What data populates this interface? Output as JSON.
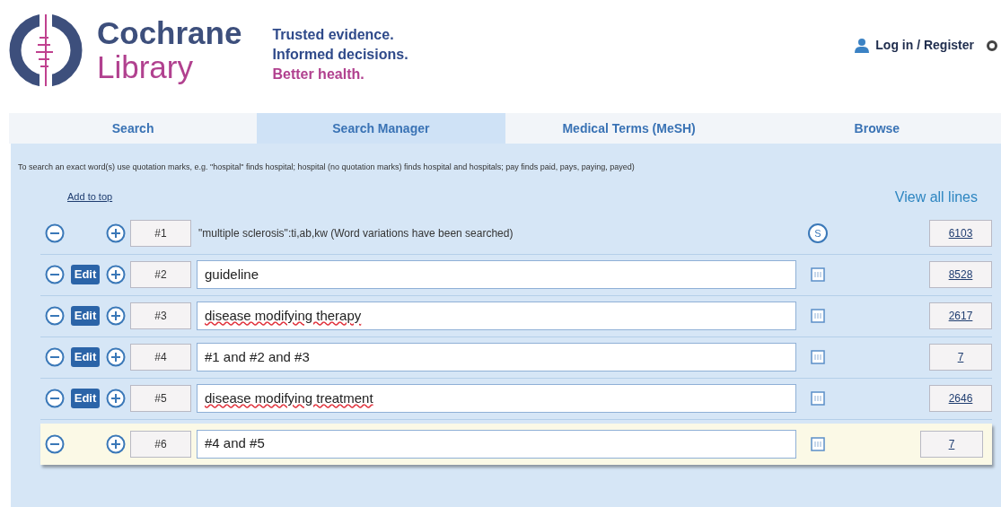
{
  "header": {
    "logo": {
      "line_1": "Cochrane",
      "line_2": "Library"
    },
    "tagline": [
      "Trusted evidence.",
      "Informed decisions.",
      "Better health."
    ],
    "login": "Log in / Register"
  },
  "tabs": [
    {
      "label": "Search",
      "selected": false
    },
    {
      "label": "Search Manager",
      "selected": true
    },
    {
      "label": "Medical Terms (MeSH)",
      "selected": false
    },
    {
      "label": "Browse",
      "selected": false
    }
  ],
  "hint": "To search an exact word(s) use quotation marks, e.g. \"hospital\" finds hospital; hospital (no quotation marks) finds hospital and hospitals; pay finds paid, pays, paying, payed)",
  "add_to_top": "Add to top",
  "view_all_lines": "View all lines",
  "lines": [
    {
      "number": "#1",
      "kind": "text",
      "query": "\"multiple sclerosis\":ti,ab,kw (Word variations have been searched)",
      "misspelled": false,
      "badge": "S",
      "count": "6103",
      "selected": false
    },
    {
      "number": "#2",
      "kind": "field",
      "query": "guideline",
      "edit": "Edit",
      "misspelled": false,
      "count": "8528",
      "selected": false
    },
    {
      "number": "#3",
      "kind": "field",
      "query": "disease modifying therapy",
      "edit": "Edit",
      "misspelled": true,
      "count": "2617",
      "selected": false
    },
    {
      "number": "#4",
      "kind": "field",
      "query": "#1 and #2 and #3",
      "edit": "Edit",
      "misspelled": false,
      "count": "7",
      "selected": false
    },
    {
      "number": "#5",
      "kind": "field",
      "query": "disease modifying treatment",
      "edit": "Edit",
      "misspelled": true,
      "count": "2646",
      "selected": false
    },
    {
      "number": "#6",
      "kind": "field",
      "query": "#4 and #5",
      "misspelled": false,
      "count": "7",
      "selected": true
    }
  ]
}
